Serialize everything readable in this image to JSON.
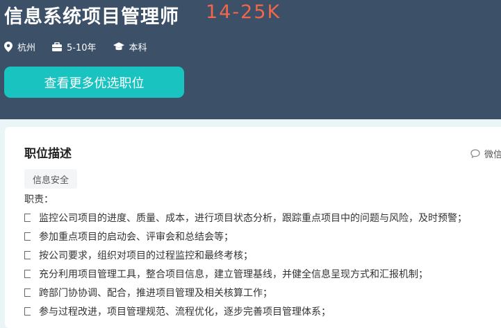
{
  "job": {
    "title": "信息系统项目管理师",
    "salary": "14-25K",
    "location": "杭州",
    "experience": "5-10年",
    "education": "本科"
  },
  "actions": {
    "more_jobs_label": "查看更多优选职位",
    "share_label": "微信"
  },
  "description": {
    "section_title": "职位描述",
    "tag": "信息安全",
    "heading": "职责：",
    "lines": [
      "监控公司项目的进度、质量、成本，进行项目状态分析，跟踪重点项目中的问题与风险，及时预警；",
      "参加重点项目的启动会、评审会和总结会等；",
      "按公司要求，组织对项目的过程监控和最终考核；",
      "充分利用项目管理工具，整合项目信息，建立管理基线，并健全信息呈现方式和汇报机制；",
      "跨部门协协调、配合，推进项目管理及相关核算工作；",
      "参与过程改进，项目管理规范、流程优化，逐步完善项目管理体系；"
    ]
  },
  "colors": {
    "header_bg": "#3c5068",
    "salary": "#f2664c",
    "button": "#19c3c0",
    "page_bg": "#e9f5f7"
  },
  "icons": {
    "location": "location-pin-icon",
    "experience": "briefcase-icon",
    "education": "graduation-cap-icon",
    "share": "chat-bubble-icon"
  }
}
